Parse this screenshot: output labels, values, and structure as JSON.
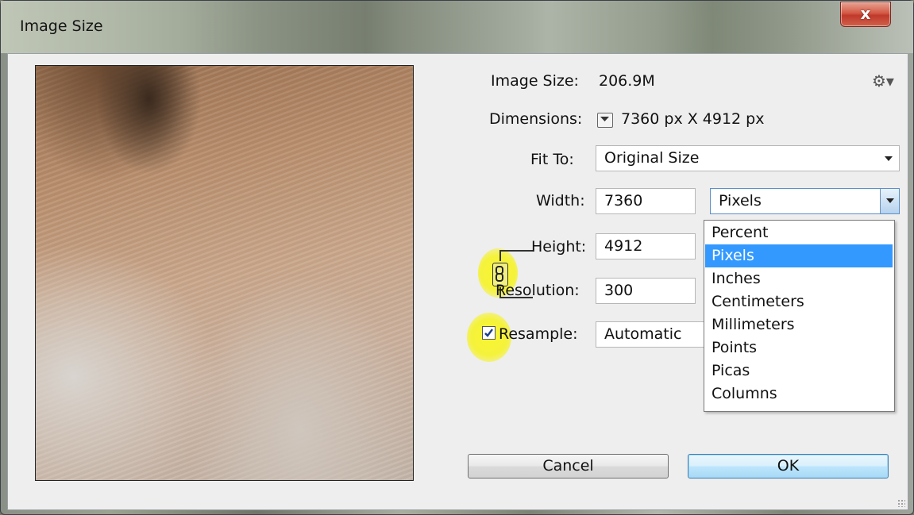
{
  "window": {
    "title": "Image Size",
    "close_label": "x"
  },
  "info": {
    "image_size_label": "Image Size:",
    "image_size_value": "206.9M",
    "dimensions_label": "Dimensions:",
    "dimensions_value": "7360 px  X  4912 px"
  },
  "fit_to": {
    "label": "Fit To:",
    "value": "Original Size"
  },
  "width": {
    "label": "Width:",
    "value": "7360",
    "unit": "Pixels"
  },
  "height": {
    "label": "Height:",
    "value": "4912"
  },
  "resolution": {
    "label": "Resolution:",
    "value": "300"
  },
  "resample": {
    "label": "Resample:",
    "value": "Automatic",
    "checked": true
  },
  "unit_options": [
    "Percent",
    "Pixels",
    "Inches",
    "Centimeters",
    "Millimeters",
    "Points",
    "Picas",
    "Columns"
  ],
  "selected_unit": "Pixels",
  "buttons": {
    "cancel": "Cancel",
    "ok": "OK"
  },
  "icons": {
    "settings": "gear-icon",
    "link": "chain-link-icon",
    "dimensions_toggle": "dropdown-arrow-icon"
  },
  "colors": {
    "highlight": "#f5f23c",
    "selection": "#3399ff",
    "close_button": "#c0392b"
  }
}
